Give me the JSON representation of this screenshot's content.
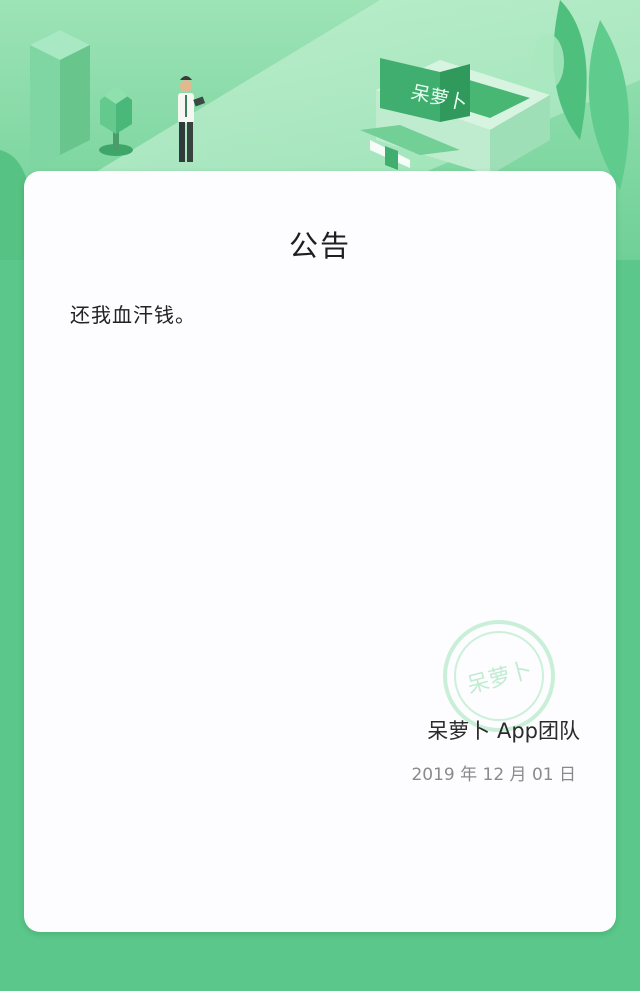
{
  "colors": {
    "background": "#5bc78a",
    "card": "#fdfdff",
    "accent_dark": "#3fae6e",
    "accent_light": "#b6ebc9"
  },
  "brand_logo_text": "呆萝卜",
  "notice": {
    "title": "公告",
    "message": "还我血汗钱。",
    "signature": "呆萝卜 App团队",
    "date": "2019 年 12 月 01 日",
    "stamp_text": "呆萝卜"
  }
}
